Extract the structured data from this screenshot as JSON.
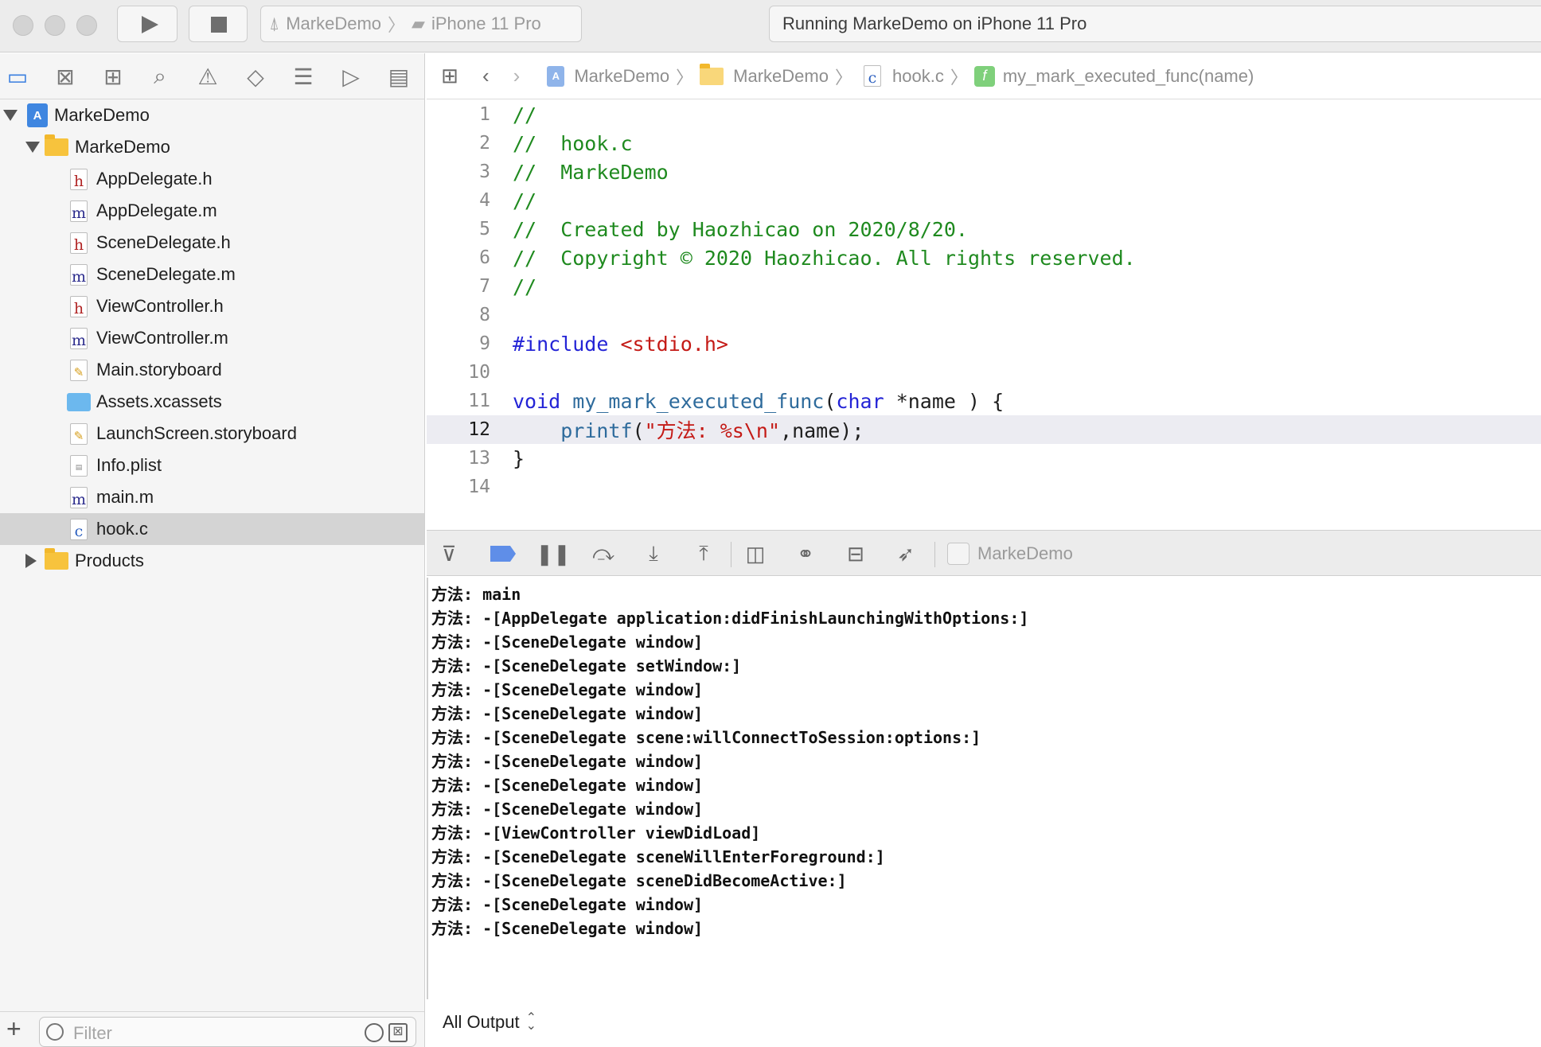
{
  "toolbar": {
    "scheme_target": "MarkeDemo",
    "scheme_device": "iPhone 11 Pro",
    "status": "Running MarkeDemo on iPhone 11 Pro"
  },
  "navigator": {
    "tree": [
      {
        "label": "MarkeDemo",
        "kind": "project",
        "level": 0,
        "expanded": true
      },
      {
        "label": "MarkeDemo",
        "kind": "folder",
        "level": 1,
        "expanded": true
      },
      {
        "label": "AppDelegate.h",
        "kind": "h",
        "level": 2
      },
      {
        "label": "AppDelegate.m",
        "kind": "m",
        "level": 2
      },
      {
        "label": "SceneDelegate.h",
        "kind": "h",
        "level": 2
      },
      {
        "label": "SceneDelegate.m",
        "kind": "m",
        "level": 2
      },
      {
        "label": "ViewController.h",
        "kind": "h",
        "level": 2
      },
      {
        "label": "ViewController.m",
        "kind": "m",
        "level": 2
      },
      {
        "label": "Main.storyboard",
        "kind": "storyboard",
        "level": 2
      },
      {
        "label": "Assets.xcassets",
        "kind": "assets",
        "level": 2
      },
      {
        "label": "LaunchScreen.storyboard",
        "kind": "storyboard",
        "level": 2
      },
      {
        "label": "Info.plist",
        "kind": "plist",
        "level": 2
      },
      {
        "label": "main.m",
        "kind": "m",
        "level": 2
      },
      {
        "label": "hook.c",
        "kind": "c",
        "level": 2,
        "selected": true
      },
      {
        "label": "Products",
        "kind": "folder",
        "level": 1,
        "expanded": false
      }
    ],
    "filter_placeholder": "Filter"
  },
  "jumpbar": {
    "crumbs": [
      "MarkeDemo",
      "MarkeDemo",
      "hook.c",
      "my_mark_executed_func(name)"
    ]
  },
  "editor": {
    "current_line": 12,
    "lines": [
      {
        "n": "1",
        "tokens": [
          {
            "t": "//",
            "c": "cm"
          }
        ]
      },
      {
        "n": "2",
        "tokens": [
          {
            "t": "//  hook.c",
            "c": "cm"
          }
        ]
      },
      {
        "n": "3",
        "tokens": [
          {
            "t": "//  MarkeDemo",
            "c": "cm"
          }
        ]
      },
      {
        "n": "4",
        "tokens": [
          {
            "t": "//",
            "c": "cm"
          }
        ]
      },
      {
        "n": "5",
        "tokens": [
          {
            "t": "//  Created by Haozhicao on 2020/8/20.",
            "c": "cm"
          }
        ]
      },
      {
        "n": "6",
        "tokens": [
          {
            "t": "//  Copyright © 2020 Haozhicao. All rights reserved.",
            "c": "cm"
          }
        ]
      },
      {
        "n": "7",
        "tokens": [
          {
            "t": "//",
            "c": "cm"
          }
        ]
      },
      {
        "n": "8",
        "tokens": []
      },
      {
        "n": "9",
        "tokens": [
          {
            "t": "#include",
            "c": "ppkw"
          },
          {
            "t": " ",
            "c": "plain"
          },
          {
            "t": "<stdio.h>",
            "c": "str"
          }
        ]
      },
      {
        "n": "10",
        "tokens": []
      },
      {
        "n": "11",
        "tokens": [
          {
            "t": "void",
            "c": "kw"
          },
          {
            "t": " ",
            "c": "plain"
          },
          {
            "t": "my_mark_executed_func",
            "c": "fn"
          },
          {
            "t": "(",
            "c": "plain"
          },
          {
            "t": "char",
            "c": "kw"
          },
          {
            "t": " *name ) {",
            "c": "plain"
          }
        ]
      },
      {
        "n": "12",
        "tokens": [
          {
            "t": "    ",
            "c": "plain"
          },
          {
            "t": "printf",
            "c": "fn"
          },
          {
            "t": "(",
            "c": "plain"
          },
          {
            "t": "\"方法: %s\\n\"",
            "c": "str"
          },
          {
            "t": ",name);",
            "c": "plain"
          }
        ]
      },
      {
        "n": "13",
        "tokens": [
          {
            "t": "}",
            "c": "plain"
          }
        ]
      },
      {
        "n": "14",
        "tokens": []
      }
    ]
  },
  "debugbar": {
    "process": "MarkeDemo"
  },
  "console": {
    "lines": [
      "方法: main",
      "方法: -[AppDelegate application:didFinishLaunchingWithOptions:]",
      "方法: -[SceneDelegate window]",
      "方法: -[SceneDelegate setWindow:]",
      "方法: -[SceneDelegate window]",
      "方法: -[SceneDelegate window]",
      "方法: -[SceneDelegate scene:willConnectToSession:options:]",
      "方法: -[SceneDelegate window]",
      "方法: -[SceneDelegate window]",
      "方法: -[SceneDelegate window]",
      "方法: -[ViewController viewDidLoad]",
      "方法: -[SceneDelegate sceneWillEnterForeground:]",
      "方法: -[SceneDelegate sceneDidBecomeActive:]",
      "方法: -[SceneDelegate window]",
      "方法: -[SceneDelegate window]"
    ],
    "output_selector": "All Output"
  },
  "colors": {
    "comment": "#1f8a1f",
    "keyword": "#2424d6",
    "string": "#c41a16",
    "function": "#2e6b9c",
    "selection": "#d4d4d4",
    "breakpoint_flag": "#5f8ee8"
  }
}
